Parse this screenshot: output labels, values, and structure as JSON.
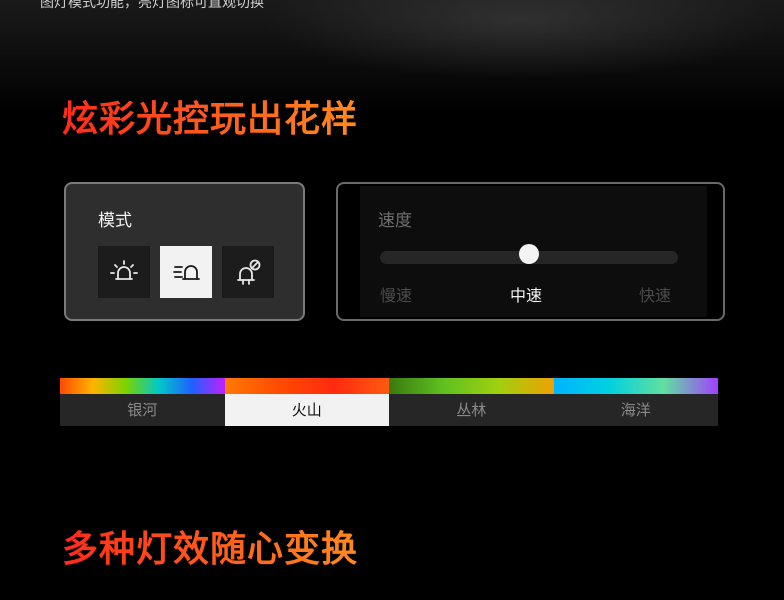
{
  "header": {
    "caption": "图灯模式功能，亮灯图标可直观切换"
  },
  "headline1": "炫彩光控玩出花样",
  "mode_panel": {
    "title": "模式",
    "modes": [
      {
        "icon": "light-on-icon",
        "selected": false
      },
      {
        "icon": "light-flash-icon",
        "selected": true
      },
      {
        "icon": "light-off-icon",
        "selected": false
      }
    ]
  },
  "speed_panel": {
    "title": "速度",
    "labels": [
      "慢速",
      "中速",
      "快速"
    ],
    "selected": "中速",
    "value_fraction": 0.5
  },
  "effects": {
    "tabs": [
      {
        "label": "银河",
        "selected": false,
        "colors": [
          "#ff4a00",
          "#ffb400",
          "#7ad400",
          "#00c8c8",
          "#2060ff",
          "#c020ff"
        ]
      },
      {
        "label": "火山",
        "selected": true,
        "colors": [
          "#ff7a00",
          "#ff4a00",
          "#ff2a10",
          "#ff5a10"
        ]
      },
      {
        "label": "丛林",
        "selected": false,
        "colors": [
          "#3a7a10",
          "#60c020",
          "#a0d010",
          "#f0a000"
        ]
      },
      {
        "label": "海洋",
        "selected": false,
        "colors": [
          "#00b4ff",
          "#00d0e0",
          "#60e0a0",
          "#a040ff"
        ]
      }
    ]
  },
  "headline2": "多种灯效随心变换",
  "colors": {
    "accent": "#ff4a1a",
    "panel": "#2e2e2e"
  }
}
